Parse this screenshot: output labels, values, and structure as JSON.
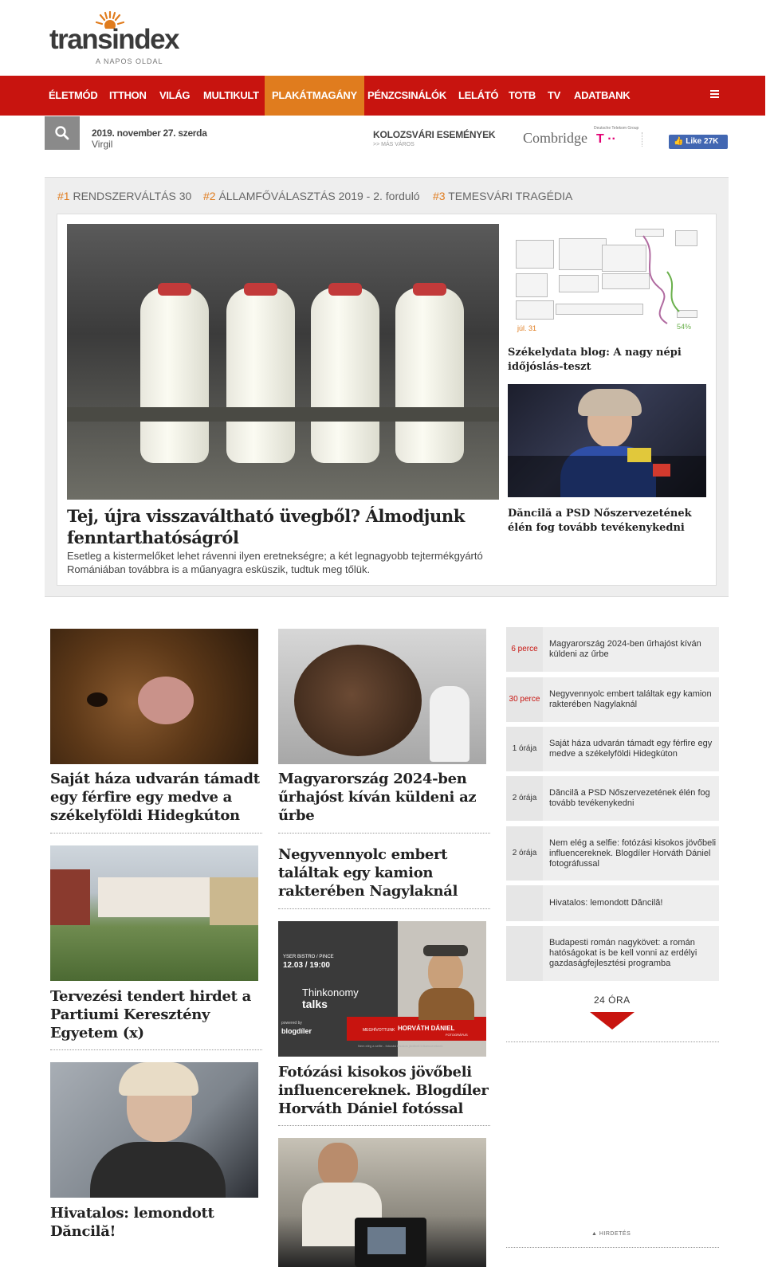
{
  "logo": {
    "name": "transindex",
    "tagline": "A NAPOS OLDAL"
  },
  "nav": {
    "items": [
      "ÉLETMÓD",
      "ITTHON",
      "VILÁG",
      "MULTIKULT",
      "PLAKÁTMAGÁNY",
      "PÉNZCSINÁLÓK",
      "LELÁTÓ",
      "TOTB",
      "TV",
      "ADATBANK"
    ],
    "active": "PLAKÁTMAGÁNY"
  },
  "infobar": {
    "date": "2019. november 27. szerda",
    "nameday": "Virgil",
    "events_title": "KOLOZSVÁRI ESEMÉNYEK",
    "events_sub": ">> MÁS VÁROS",
    "sponsor": "Combridge",
    "sponsor_small": "Deutsche Telekom Group",
    "telekom": "T ··",
    "like_label": "Like 27K"
  },
  "topics": [
    {
      "num": "#1",
      "label": "RENDSZERVÁLTÁS 30"
    },
    {
      "num": "#2",
      "label": "ÁLLAMFŐVÁLASZTÁS 2019 - 2. forduló"
    },
    {
      "num": "#3",
      "label": "TEMESVÁRI TRAGÉDIA"
    }
  ],
  "featured": {
    "title": "Tej, újra visszaváltható üvegből? Álmodjunk fenntarthatóságról",
    "lead": "Esetleg a kistermelőket lehet rávenni ilyen eretnekségre; a két legnagyobb tejtermékgyártó Romániában továbbra is a műanyagra esküszik, tudtuk meg tőlük."
  },
  "side_articles": [
    {
      "title": "Székelydata blog: A nagy népi időjóslás-teszt",
      "graphic_date": "júl. 31",
      "graphic_pct": "54%"
    },
    {
      "title": "Dăncilă a PSD Nőszervezetének élén fog tovább tevékenykedni"
    }
  ],
  "cards": [
    {
      "title": "Saját háza udvarán támadt egy férfire egy medve a székelyföldi Hidegkúton"
    },
    {
      "title": "Magyarország 2024-ben űrhajóst kíván küldeni az űrbe"
    },
    {
      "title": "Tervezési tendert hirdet a Partiumi Keresztény Egyetem (x)"
    },
    {
      "title": "Negyvennyolc embert találtak egy kamion rakterében Nagylaknál"
    },
    {
      "title": "Fotózási kisokos jövőbeli influencereknek. Blogdíler Horváth Dániel fotóssal"
    },
    {
      "title": "Hivatalos: lemondott Dăncilă!"
    }
  ],
  "thinkonomy": {
    "venue": "YSER BISTRO / PINCE",
    "datetime": "12.03 / 19:00",
    "brand_line1": "Thinkonomy",
    "brand_line2": "talks",
    "powered": "powered by",
    "blogdiler": "blogdíler",
    "invited": "MEGHÍVOTTUNK",
    "guest": "HORVÁTH DÁNIEL",
    "guest_role": "FOTOGRÁFUS",
    "footer": "Nem elég a selfie - fotózási kisokos jövőbeli influencereknek"
  },
  "feed": [
    {
      "time": "6 perce",
      "red": true,
      "text": "Magyarország 2024-ben űrhajóst kíván küldeni az űrbe"
    },
    {
      "time": "30 perce",
      "red": true,
      "text": "Negyvennyolc embert találtak egy kamion rakterében Nagylaknál"
    },
    {
      "time": "1 órája",
      "red": false,
      "text": "Saját háza udvarán támadt egy férfire egy medve a székelyföldi Hidegkúton"
    },
    {
      "time": "2 órája",
      "red": false,
      "text": "Dăncilă a PSD Nőszervezetének élén fog tovább tevékenykedni"
    },
    {
      "time": "2 órája",
      "red": false,
      "text": "Nem elég a selfie: fotózási kisokos jövőbeli influencereknek. Blogdíler Horváth Dániel fotográfussal"
    },
    {
      "time": "",
      "red": false,
      "text": "Hivatalos: lemondott Dăncilă!"
    },
    {
      "time": "",
      "red": false,
      "text": "Budapesti román nagykövet: a román hatóságokat is be kell vonni az erdélyi gazdaságfejlesztési programba"
    }
  ],
  "more24": "24 ÓRA",
  "ad_label": "HIRDETÉS",
  "colors": {
    "brand_red": "#c8140f",
    "accent_orange": "#e07c1e",
    "fb_blue": "#4267b2"
  }
}
